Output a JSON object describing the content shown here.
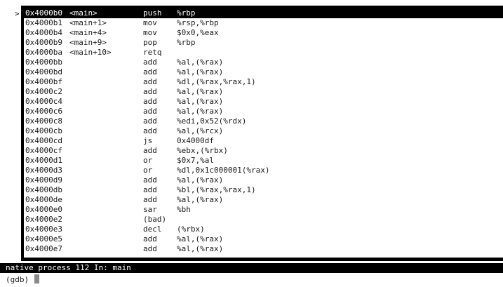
{
  "marker": ">",
  "rows": [
    {
      "addr": "0x4000b0",
      "sym": "<main>",
      "mnem": "push",
      "ops": "%rbp",
      "current": true
    },
    {
      "addr": "0x4000b1",
      "sym": "<main+1>",
      "mnem": "mov",
      "ops": "%rsp,%rbp"
    },
    {
      "addr": "0x4000b4",
      "sym": "<main+4>",
      "mnem": "mov",
      "ops": "$0x0,%eax"
    },
    {
      "addr": "0x4000b9",
      "sym": "<main+9>",
      "mnem": "pop",
      "ops": "%rbp"
    },
    {
      "addr": "0x4000ba",
      "sym": "<main+10>",
      "mnem": "retq",
      "ops": ""
    },
    {
      "addr": "0x4000bb",
      "sym": "",
      "mnem": "add",
      "ops": "%al,(%rax)"
    },
    {
      "addr": "0x4000bd",
      "sym": "",
      "mnem": "add",
      "ops": "%al,(%rax)"
    },
    {
      "addr": "0x4000bf",
      "sym": "",
      "mnem": "add",
      "ops": "%dl,(%rax,%rax,1)"
    },
    {
      "addr": "0x4000c2",
      "sym": "",
      "mnem": "add",
      "ops": "%al,(%rax)"
    },
    {
      "addr": "0x4000c4",
      "sym": "",
      "mnem": "add",
      "ops": "%al,(%rax)"
    },
    {
      "addr": "0x4000c6",
      "sym": "",
      "mnem": "add",
      "ops": "%al,(%rax)"
    },
    {
      "addr": "0x4000c8",
      "sym": "",
      "mnem": "add",
      "ops": "%edi,0x52(%rdx)"
    },
    {
      "addr": "0x4000cb",
      "sym": "",
      "mnem": "add",
      "ops": "%al,(%rcx)"
    },
    {
      "addr": "0x4000cd",
      "sym": "",
      "mnem": "js",
      "ops": "0x4000df"
    },
    {
      "addr": "0x4000cf",
      "sym": "",
      "mnem": "add",
      "ops": "%ebx,(%rbx)"
    },
    {
      "addr": "0x4000d1",
      "sym": "",
      "mnem": "or",
      "ops": "$0x7,%al"
    },
    {
      "addr": "0x4000d3",
      "sym": "",
      "mnem": "or",
      "ops": "%dl,0x1c000001(%rax)"
    },
    {
      "addr": "0x4000d9",
      "sym": "",
      "mnem": "add",
      "ops": "%al,(%rax)"
    },
    {
      "addr": "0x4000db",
      "sym": "",
      "mnem": "add",
      "ops": "%bl,(%rax,%rax,1)"
    },
    {
      "addr": "0x4000de",
      "sym": "",
      "mnem": "add",
      "ops": "%al,(%rax)"
    },
    {
      "addr": "0x4000e0",
      "sym": "",
      "mnem": "sar",
      "ops": "%bh"
    },
    {
      "addr": "0x4000e2",
      "sym": "",
      "mnem": "(bad)",
      "ops": ""
    },
    {
      "addr": "0x4000e3",
      "sym": "",
      "mnem": "decl",
      "ops": "(%rbx)"
    },
    {
      "addr": "0x4000e5",
      "sym": "",
      "mnem": "add",
      "ops": "%al,(%rax)"
    },
    {
      "addr": "0x4000e7",
      "sym": "",
      "mnem": "add",
      "ops": "%al,(%rax)"
    }
  ],
  "status": {
    "text": "native process 112 In: main"
  },
  "prompt": {
    "text": "(gdb) "
  }
}
